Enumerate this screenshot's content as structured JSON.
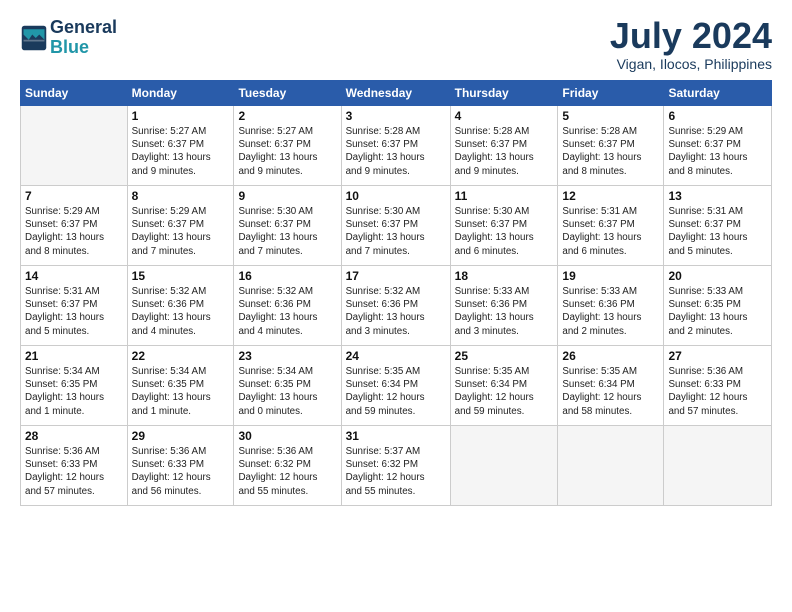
{
  "header": {
    "logo_line1": "General",
    "logo_line2": "Blue",
    "month": "July 2024",
    "location": "Vigan, Ilocos, Philippines"
  },
  "weekdays": [
    "Sunday",
    "Monday",
    "Tuesday",
    "Wednesday",
    "Thursday",
    "Friday",
    "Saturday"
  ],
  "weeks": [
    [
      {
        "day": "",
        "info": ""
      },
      {
        "day": "1",
        "info": "Sunrise: 5:27 AM\nSunset: 6:37 PM\nDaylight: 13 hours\nand 9 minutes."
      },
      {
        "day": "2",
        "info": "Sunrise: 5:27 AM\nSunset: 6:37 PM\nDaylight: 13 hours\nand 9 minutes."
      },
      {
        "day": "3",
        "info": "Sunrise: 5:28 AM\nSunset: 6:37 PM\nDaylight: 13 hours\nand 9 minutes."
      },
      {
        "day": "4",
        "info": "Sunrise: 5:28 AM\nSunset: 6:37 PM\nDaylight: 13 hours\nand 9 minutes."
      },
      {
        "day": "5",
        "info": "Sunrise: 5:28 AM\nSunset: 6:37 PM\nDaylight: 13 hours\nand 8 minutes."
      },
      {
        "day": "6",
        "info": "Sunrise: 5:29 AM\nSunset: 6:37 PM\nDaylight: 13 hours\nand 8 minutes."
      }
    ],
    [
      {
        "day": "7",
        "info": "Sunrise: 5:29 AM\nSunset: 6:37 PM\nDaylight: 13 hours\nand 8 minutes."
      },
      {
        "day": "8",
        "info": "Sunrise: 5:29 AM\nSunset: 6:37 PM\nDaylight: 13 hours\nand 7 minutes."
      },
      {
        "day": "9",
        "info": "Sunrise: 5:30 AM\nSunset: 6:37 PM\nDaylight: 13 hours\nand 7 minutes."
      },
      {
        "day": "10",
        "info": "Sunrise: 5:30 AM\nSunset: 6:37 PM\nDaylight: 13 hours\nand 7 minutes."
      },
      {
        "day": "11",
        "info": "Sunrise: 5:30 AM\nSunset: 6:37 PM\nDaylight: 13 hours\nand 6 minutes."
      },
      {
        "day": "12",
        "info": "Sunrise: 5:31 AM\nSunset: 6:37 PM\nDaylight: 13 hours\nand 6 minutes."
      },
      {
        "day": "13",
        "info": "Sunrise: 5:31 AM\nSunset: 6:37 PM\nDaylight: 13 hours\nand 5 minutes."
      }
    ],
    [
      {
        "day": "14",
        "info": "Sunrise: 5:31 AM\nSunset: 6:37 PM\nDaylight: 13 hours\nand 5 minutes."
      },
      {
        "day": "15",
        "info": "Sunrise: 5:32 AM\nSunset: 6:36 PM\nDaylight: 13 hours\nand 4 minutes."
      },
      {
        "day": "16",
        "info": "Sunrise: 5:32 AM\nSunset: 6:36 PM\nDaylight: 13 hours\nand 4 minutes."
      },
      {
        "day": "17",
        "info": "Sunrise: 5:32 AM\nSunset: 6:36 PM\nDaylight: 13 hours\nand 3 minutes."
      },
      {
        "day": "18",
        "info": "Sunrise: 5:33 AM\nSunset: 6:36 PM\nDaylight: 13 hours\nand 3 minutes."
      },
      {
        "day": "19",
        "info": "Sunrise: 5:33 AM\nSunset: 6:36 PM\nDaylight: 13 hours\nand 2 minutes."
      },
      {
        "day": "20",
        "info": "Sunrise: 5:33 AM\nSunset: 6:35 PM\nDaylight: 13 hours\nand 2 minutes."
      }
    ],
    [
      {
        "day": "21",
        "info": "Sunrise: 5:34 AM\nSunset: 6:35 PM\nDaylight: 13 hours\nand 1 minute."
      },
      {
        "day": "22",
        "info": "Sunrise: 5:34 AM\nSunset: 6:35 PM\nDaylight: 13 hours\nand 1 minute."
      },
      {
        "day": "23",
        "info": "Sunrise: 5:34 AM\nSunset: 6:35 PM\nDaylight: 13 hours\nand 0 minutes."
      },
      {
        "day": "24",
        "info": "Sunrise: 5:35 AM\nSunset: 6:34 PM\nDaylight: 12 hours\nand 59 minutes."
      },
      {
        "day": "25",
        "info": "Sunrise: 5:35 AM\nSunset: 6:34 PM\nDaylight: 12 hours\nand 59 minutes."
      },
      {
        "day": "26",
        "info": "Sunrise: 5:35 AM\nSunset: 6:34 PM\nDaylight: 12 hours\nand 58 minutes."
      },
      {
        "day": "27",
        "info": "Sunrise: 5:36 AM\nSunset: 6:33 PM\nDaylight: 12 hours\nand 57 minutes."
      }
    ],
    [
      {
        "day": "28",
        "info": "Sunrise: 5:36 AM\nSunset: 6:33 PM\nDaylight: 12 hours\nand 57 minutes."
      },
      {
        "day": "29",
        "info": "Sunrise: 5:36 AM\nSunset: 6:33 PM\nDaylight: 12 hours\nand 56 minutes."
      },
      {
        "day": "30",
        "info": "Sunrise: 5:36 AM\nSunset: 6:32 PM\nDaylight: 12 hours\nand 55 minutes."
      },
      {
        "day": "31",
        "info": "Sunrise: 5:37 AM\nSunset: 6:32 PM\nDaylight: 12 hours\nand 55 minutes."
      },
      {
        "day": "",
        "info": ""
      },
      {
        "day": "",
        "info": ""
      },
      {
        "day": "",
        "info": ""
      }
    ]
  ]
}
